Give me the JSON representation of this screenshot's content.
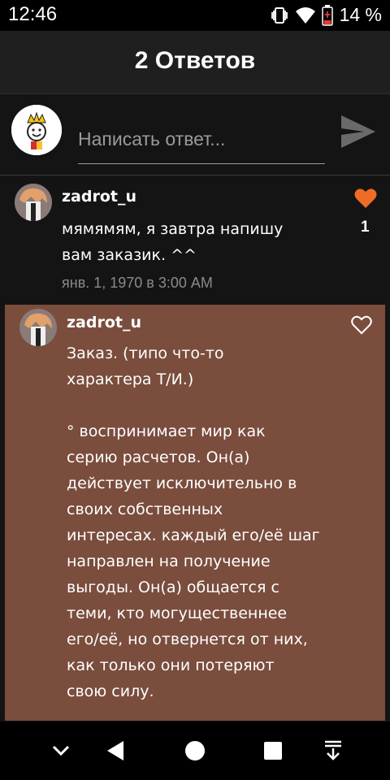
{
  "status": {
    "time": "12:46",
    "battery": "14 %"
  },
  "header": {
    "title": "2 Ответов"
  },
  "composer": {
    "placeholder": "Написать ответ..."
  },
  "comments": [
    {
      "username": "zadrot_u",
      "text": "мямямям, я завтра напишу\nвам заказик. ^^",
      "date": "янв. 1, 1970 в 3:00 AM",
      "likes": "1",
      "liked": true
    },
    {
      "username": "zadrot_u",
      "text": "Заказ. (типо что-то\nхарактера Т/И.)\n\n° воспринимает мир как\nсерию расчетов. Он(а)\nдействует исключительно в\nсвоих собственных\nинтересах. каждый его/её шаг\nнаправлен на получение\nвыгоды. Он(а) общается с\nтеми, кто могущественнее\nего/её, но отвернется от них,\nкак только они потеряют\nсвою силу.",
      "liked": false
    }
  ],
  "colors": {
    "like_active": "#f06b26",
    "highlight_bg": "#7a4d3d"
  },
  "icons": [
    "vibrate-icon",
    "wifi-icon",
    "battery-icon",
    "send-icon",
    "heart-filled-icon",
    "heart-outline-icon",
    "chevron-down-icon",
    "back-icon",
    "home-icon",
    "recents-icon",
    "notifications-icon"
  ]
}
